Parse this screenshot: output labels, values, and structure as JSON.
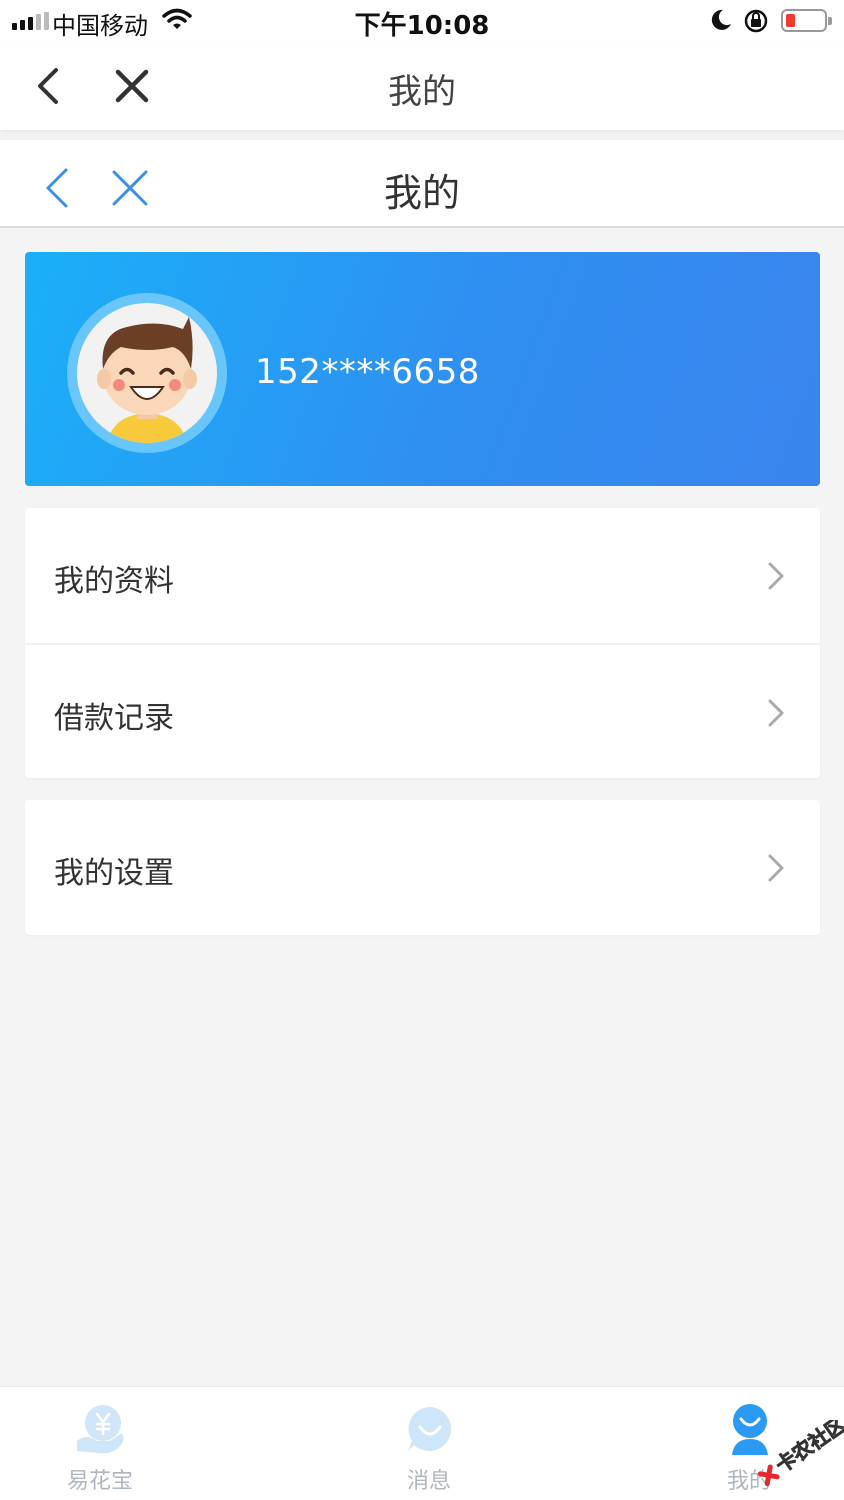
{
  "status_bar": {
    "carrier": "中国移动",
    "time": "下午10:08"
  },
  "outer_nav": {
    "title": "我的"
  },
  "inner_nav": {
    "title": "我的"
  },
  "profile": {
    "phone": "152****6658"
  },
  "menu": {
    "group1": [
      {
        "label": "我的资料"
      },
      {
        "label": "借款记录"
      }
    ],
    "group2": [
      {
        "label": "我的设置"
      }
    ]
  },
  "tabbar": {
    "tabs": [
      {
        "label": "易花宝",
        "icon": "yen-hand-icon"
      },
      {
        "label": "消息",
        "icon": "smile-bubble-icon"
      },
      {
        "label": "我的",
        "icon": "user-icon",
        "active": true
      }
    ]
  },
  "watermark": {
    "text": "卡农社区"
  },
  "colors": {
    "accent": "#2f8ff1",
    "card_start": "#1ab0f9",
    "card_end": "#3a84ee",
    "nav_blue": "#3b8fe8",
    "tab_inactive": "#aeb6c0",
    "tab_active": "#2a9af5"
  }
}
